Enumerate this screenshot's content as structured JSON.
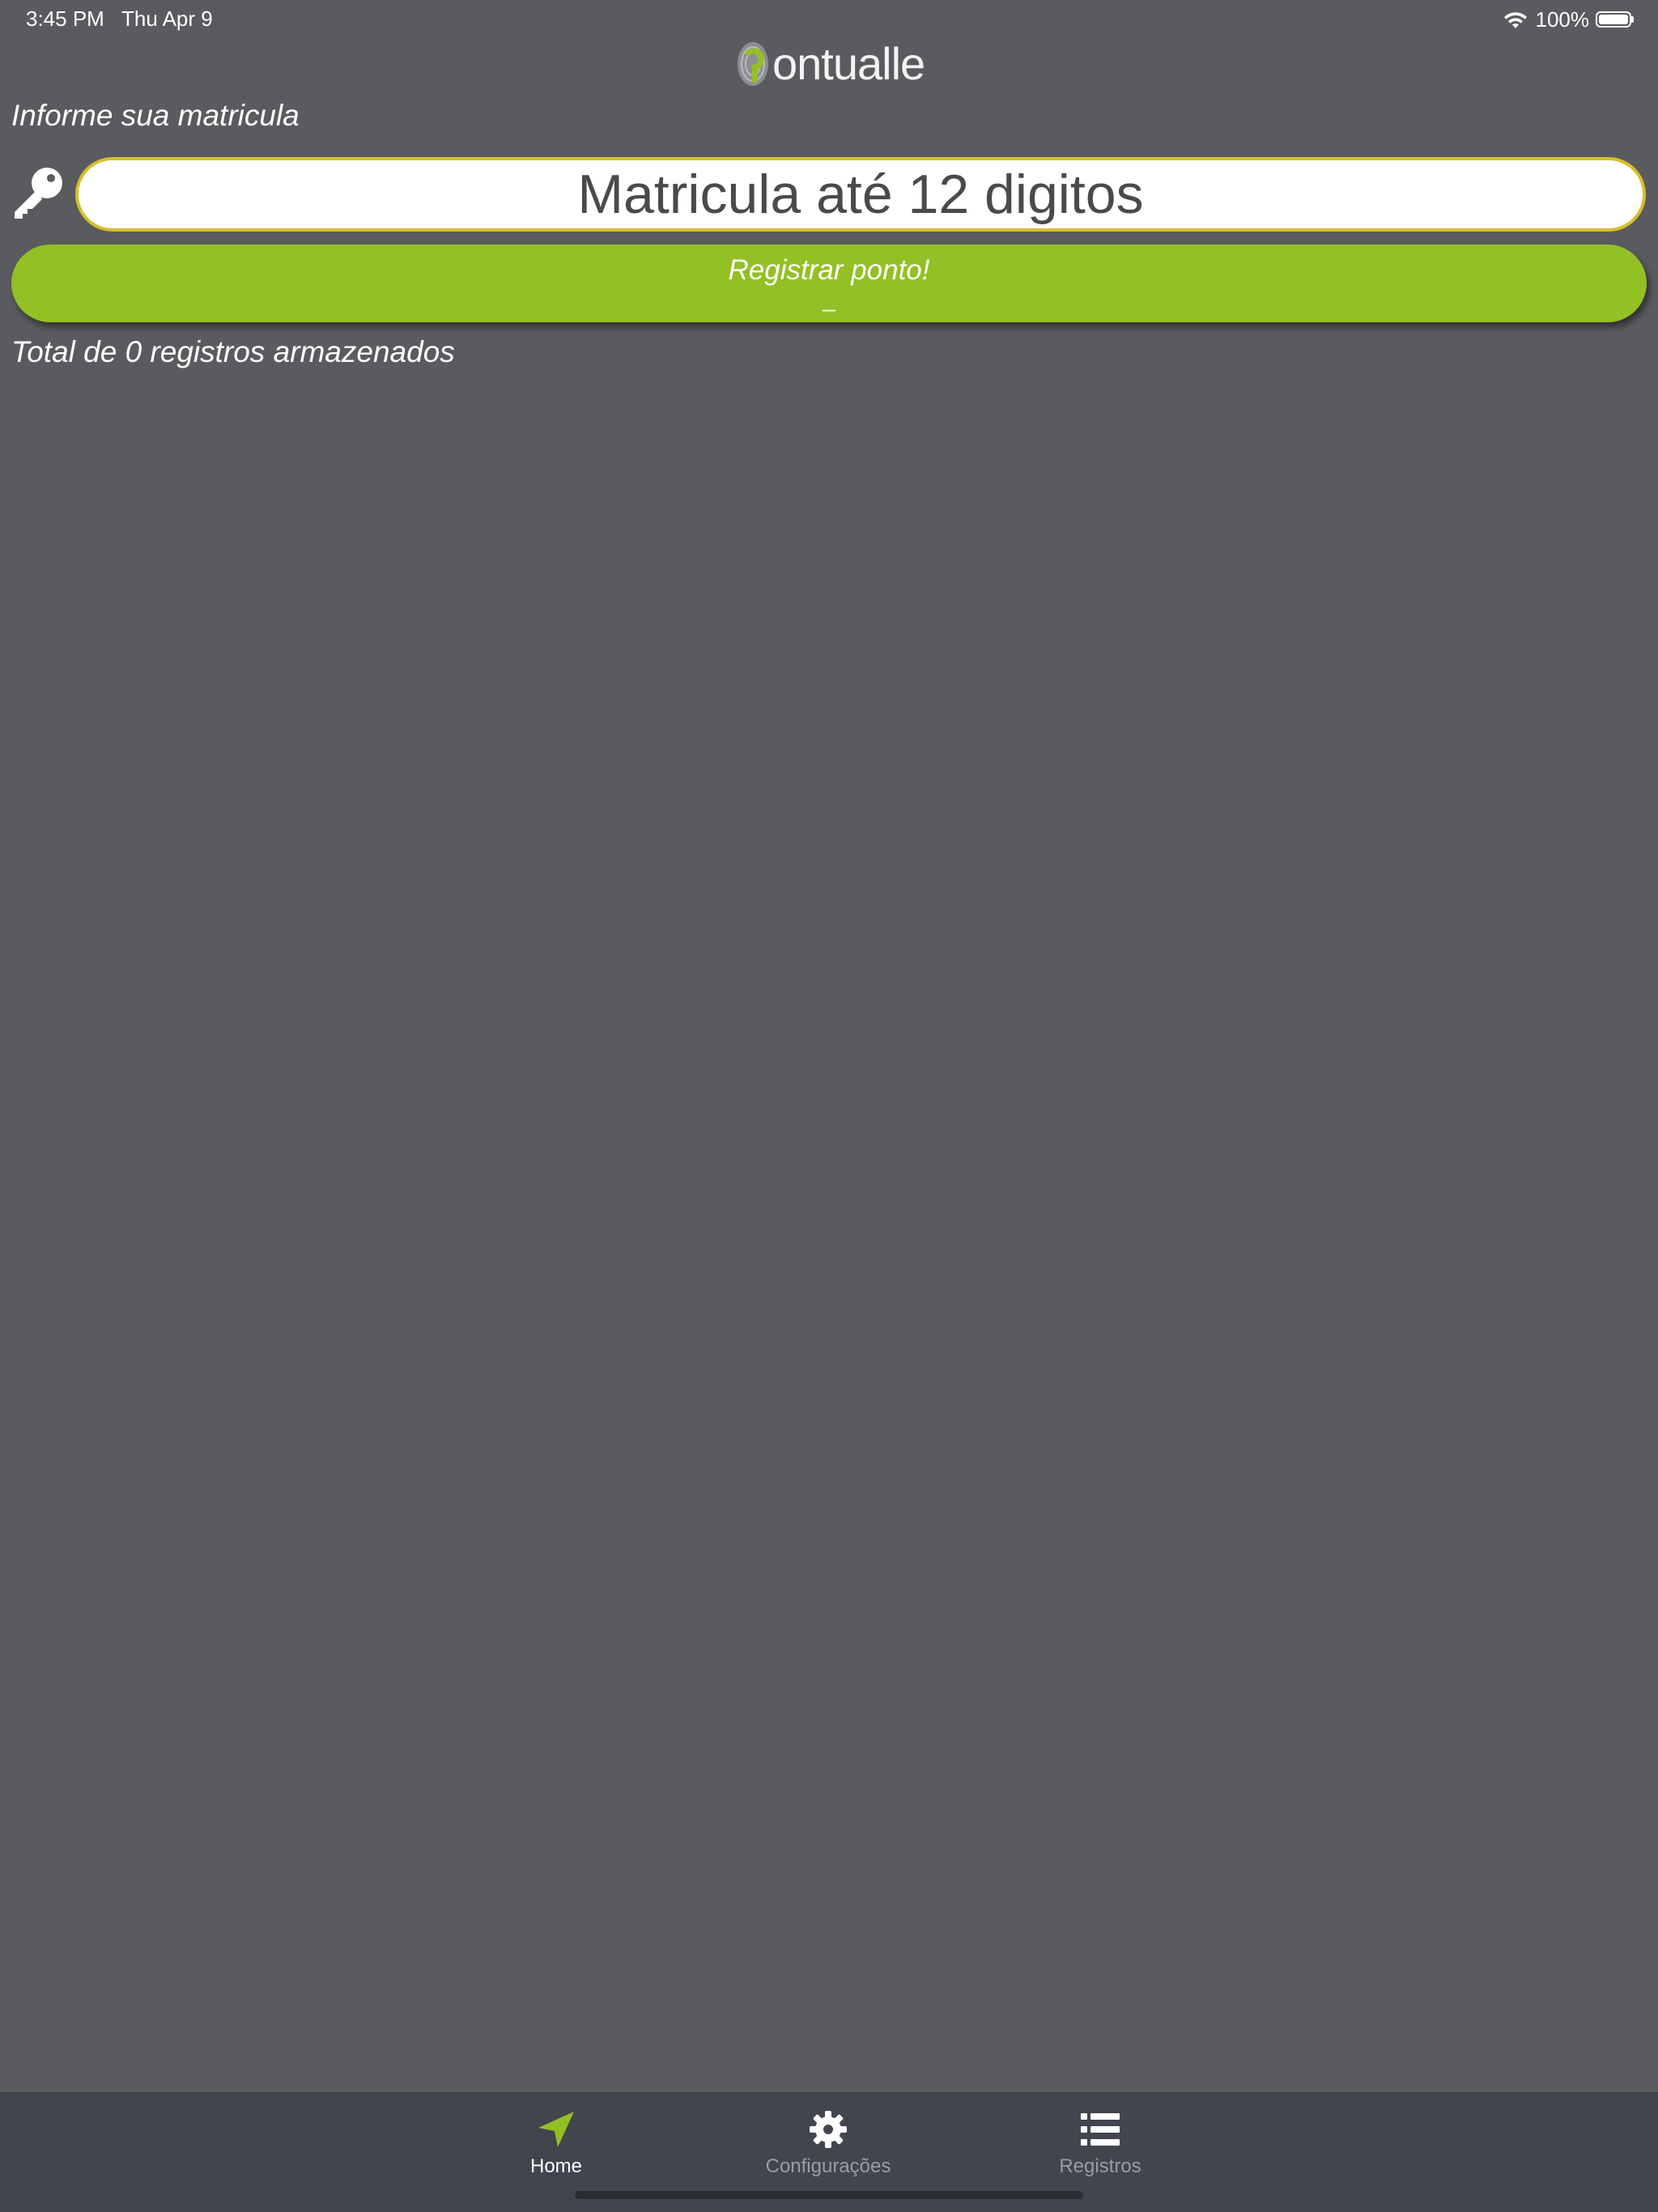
{
  "status_bar": {
    "time": "3:45 PM",
    "date": "Thu Apr 9",
    "battery": "100%"
  },
  "logo": {
    "text": "ontualle"
  },
  "form": {
    "prompt": "Informe sua matricula",
    "input_placeholder": "Matricula até 12 digitos",
    "input_value": "",
    "register_label": "Registrar ponto!",
    "register_sublabel": "_"
  },
  "summary": {
    "total_text": "Total de 0 registros armazenados"
  },
  "tab_bar": {
    "tabs": [
      {
        "label": "Home",
        "icon": "navigation-arrow-icon",
        "active": true
      },
      {
        "label": "Configurações",
        "icon": "gear-icon",
        "active": false
      },
      {
        "label": "Registros",
        "icon": "list-icon",
        "active": false
      }
    ]
  },
  "colors": {
    "background": "#5a5b5e",
    "accent_green": "#93c024",
    "input_border": "#d7be2b",
    "tab_bar": "#41454e",
    "inactive_tab": "#9a9ca3"
  }
}
